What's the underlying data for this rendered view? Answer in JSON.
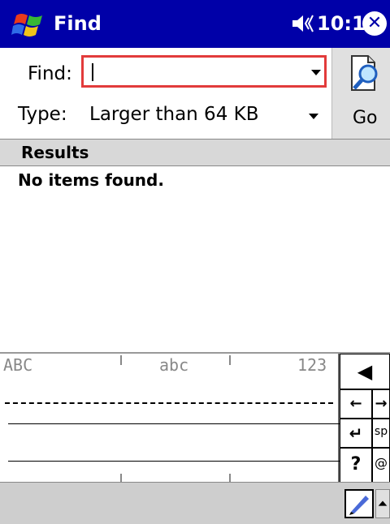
{
  "titlebar": {
    "title": "Find",
    "time": "10:19",
    "start_icon": "windows-flag-icon",
    "volume_icon": "speaker-icon",
    "close_icon": "close-icon",
    "color": "#0000a8"
  },
  "find": {
    "find_label": "Find:",
    "find_value": "",
    "type_label": "Type:",
    "type_value": "Larger than 64 KB",
    "go_label": "Go",
    "go_icon": "document-magnifier-icon",
    "field_border_color": "#e23b3b"
  },
  "results": {
    "header": "Results",
    "empty_message": "No items found."
  },
  "keyboard": {
    "modes": [
      "ABC",
      "abc",
      "123"
    ],
    "backspace_icon": "backspace-arrow-icon",
    "left_arrow_icon": "left-arrow-icon",
    "right_arrow_icon": "right-arrow-icon",
    "enter_icon": "enter-icon",
    "space_label": "sp",
    "question_label": "?",
    "at_label": "@"
  },
  "menubar": {
    "input_icon": "pen-icon",
    "sip_toggle_icon": "up-arrow-icon"
  }
}
